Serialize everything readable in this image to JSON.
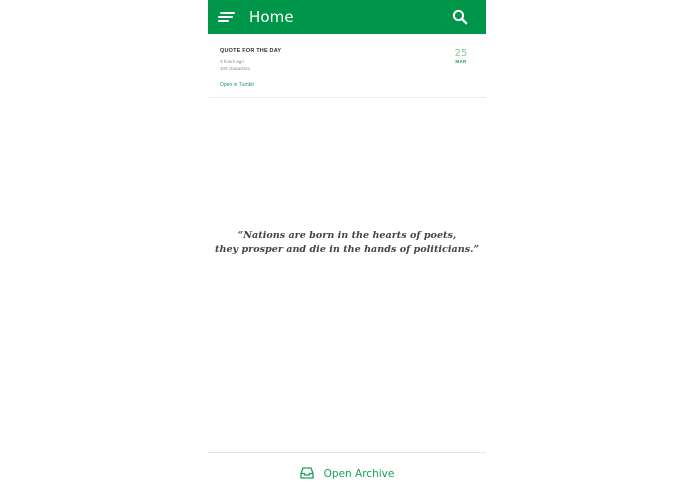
{
  "appbar": {
    "title": "Home",
    "menu_icon": "menu-icon",
    "search_icon": "search-icon",
    "color": "#00964a"
  },
  "post": {
    "title": "QUOTE FOR THE DAY",
    "time": "3 hours ago",
    "characters": "100 characters",
    "link_label": "Open in Tumblr",
    "date_day": "25",
    "date_month": "MAR"
  },
  "quote": {
    "line1": "“Nations are born in the hearts of poets,",
    "line2": "they prosper and die in the hands of politicians.”"
  },
  "footer": {
    "archive_label": "Open Archive",
    "archive_icon": "inbox-icon",
    "accent": "#1aa05a"
  }
}
